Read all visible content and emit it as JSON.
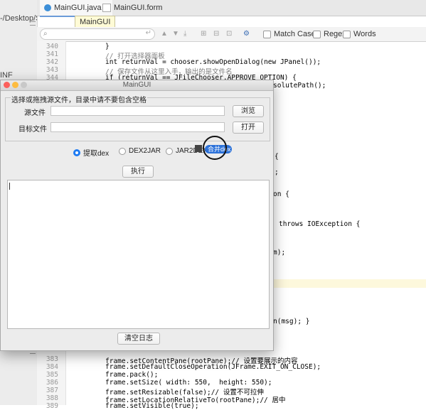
{
  "ide": {
    "breadcrumb_path": "-/Desktop/S",
    "left_label": "INF",
    "tabs": [
      {
        "label": "MainGUI.java",
        "close": "×"
      },
      {
        "label": "MainGUI.form"
      }
    ],
    "tooltip": "MainGUI",
    "find": {
      "placeholder": "Q•",
      "match_case": "Match Case",
      "regex": "Regex",
      "words": "Words"
    },
    "code_lines": [
      {
        "num": "340",
        "text": "}"
      },
      {
        "num": "341",
        "text": "// 打开选择器面板"
      },
      {
        "num": "342",
        "text": "int returnVal = chooser.showOpenDialog(new JPanel());"
      },
      {
        "num": "343",
        "text": "// 保存文件从这里入手，输出的是文件名"
      },
      {
        "num": "344",
        "text": "if (returnVal == JFileChooser.APPROVE_OPTION) {"
      },
      {
        "num": "383",
        "text": "frame.setContentPane(rootPane);// 设置要展示的内容"
      },
      {
        "num": "384",
        "text": "frame.setDefaultCloseOperation(JFrame.EXIT_ON_CLOSE);"
      },
      {
        "num": "385",
        "text": "frame.pack();"
      },
      {
        "num": "386",
        "text": "frame.setSize( width: 550,  height: 550);"
      },
      {
        "num": "387",
        "text": "frame.setResizable(false);// 设置不可拉伸"
      },
      {
        "num": "388",
        "text": "frame.setLocationRelativeTo(rootPane);// 居中"
      },
      {
        "num": "389",
        "text": "frame.setVisible(true);"
      }
    ],
    "fragments": {
      "abs_path": "solutePath();",
      "brace1": "{",
      "semi": ";",
      "on_brace": "on {",
      "throws": "throws IOException {",
      "m_end": "m);",
      "msg": "n(msg); }"
    }
  },
  "window": {
    "title": "MainGUI",
    "group_title": "选择或拖拽源文件，目录中请不要包含空格",
    "source_label": "源文件",
    "target_label": "目标文件",
    "source_value": "",
    "target_value": "",
    "browse_button": "浏览",
    "open_button": "打开",
    "radios": [
      {
        "label": "提取dex",
        "selected": true
      },
      {
        "label": "DEX2JAR",
        "selected": false
      },
      {
        "label": "JAR2DEX",
        "selected": false
      }
    ],
    "highlighted_option": "合并dex",
    "execute_button": "执行",
    "log_text": "",
    "clear_log_button": "清空日志"
  },
  "colors": {
    "accent": "#1e7bf2",
    "tooltip_bg": "#fffbd6",
    "window_bg": "#ececec"
  }
}
